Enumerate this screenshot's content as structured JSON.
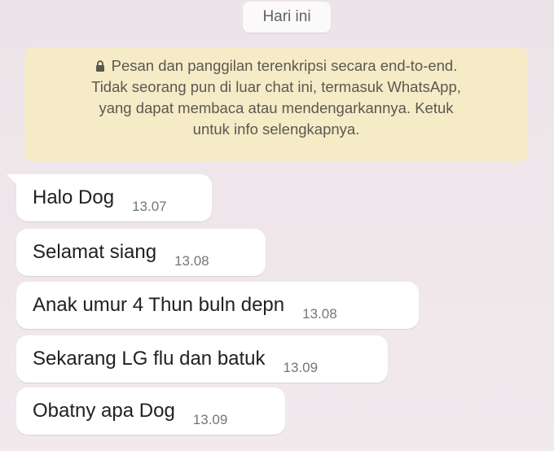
{
  "chat": {
    "date_chip": "Hari ini",
    "encryption_notice": {
      "icon": "lock-icon",
      "lines": [
        "Pesan dan panggilan terenkripsi secara end-to-end.",
        "Tidak seorang pun di luar chat ini, termasuk WhatsApp,",
        "yang dapat membaca atau mendengarkannya. Ketuk",
        "untuk info selengkapnya."
      ]
    },
    "messages": [
      {
        "text": "Halo Dog",
        "time": "13.07"
      },
      {
        "text": "Selamat siang",
        "time": "13.08"
      },
      {
        "text": "Anak umur 4 Thun buln depn",
        "time": "13.08"
      },
      {
        "text": "Sekarang LG flu dan batuk",
        "time": "13.09"
      },
      {
        "text": "Obatny apa Dog",
        "time": "13.09"
      }
    ]
  },
  "colors": {
    "background": "#efe6ea",
    "notice_background": "#f6ebc7",
    "bubble_background": "#ffffff",
    "text": "#202124",
    "timestamp": "#737679"
  }
}
